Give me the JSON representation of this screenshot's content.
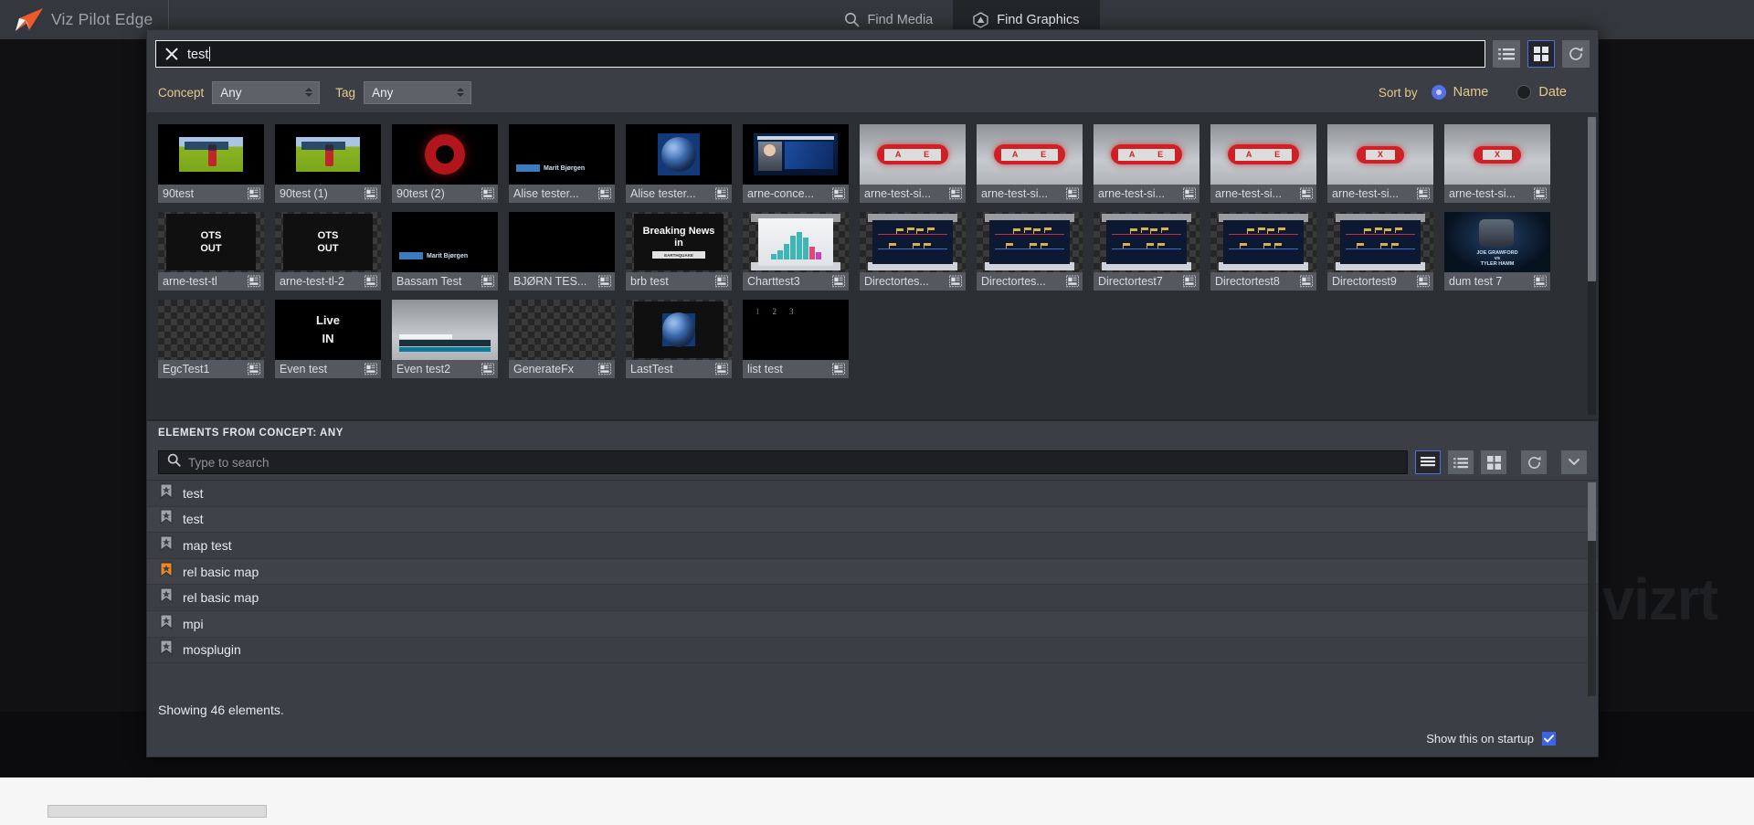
{
  "app": {
    "brand": "Viz Pilot Edge",
    "logo_icon": "viz-arrow-logo"
  },
  "topbar": {
    "tabs": [
      {
        "label": "Find Media",
        "icon": "search-icon",
        "active": false
      },
      {
        "label": "Find Graphics",
        "icon": "hexagon-graphics-icon",
        "active": true
      }
    ]
  },
  "search": {
    "value": "test",
    "clear_icon": "close-x-icon",
    "view_list_icon": "list-view-icon",
    "view_grid_icon": "grid-view-icon",
    "refresh_icon": "refresh-icon",
    "active_view": "grid"
  },
  "filters": {
    "concept_label": "Concept",
    "concept_value": "Any",
    "tag_label": "Tag",
    "tag_value": "Any",
    "sort_by_label": "Sort by",
    "sort_options": [
      {
        "label": "Name",
        "selected": true
      },
      {
        "label": "Date",
        "selected": false
      }
    ]
  },
  "grid": {
    "template_icon": "template-badge-icon",
    "items": [
      {
        "name": "90test",
        "art": "field",
        "row": 1
      },
      {
        "name": "90test (1)",
        "art": "field",
        "row": 1
      },
      {
        "name": "90test (2)",
        "art": "torus",
        "row": 1
      },
      {
        "name": "Alise tester...",
        "art": "lower3rd",
        "row": 1,
        "caption": "Marit Bjørgen"
      },
      {
        "name": "Alise tester...",
        "art": "globe",
        "row": 1
      },
      {
        "name": "arne-conce...",
        "art": "presenter",
        "row": 1
      },
      {
        "name": "arne-test-si...",
        "art": "ae-badge",
        "row": 1
      },
      {
        "name": "arne-test-si...",
        "art": "ae-badge",
        "row": 1
      },
      {
        "name": "arne-test-si...",
        "art": "ae-badge",
        "row": 1
      },
      {
        "name": "arne-test-si...",
        "art": "ae-badge",
        "row": 1
      },
      {
        "name": "arne-test-si...",
        "art": "x-badge",
        "row": 2
      },
      {
        "name": "arne-test-si...",
        "art": "x-badge",
        "row": 2
      },
      {
        "name": "arne-test-tl",
        "art": "ots",
        "row": 2,
        "caption": "OTS OUT"
      },
      {
        "name": "arne-test-tl-2",
        "art": "ots",
        "row": 2,
        "caption": "OTS OUT"
      },
      {
        "name": "Bassam Test",
        "art": "lower3rd",
        "row": 2,
        "caption": "Marit Bjørgen"
      },
      {
        "name": "BJØRN TES...",
        "art": "black",
        "row": 2
      },
      {
        "name": "brb test",
        "art": "breaking",
        "row": 2,
        "caption": "Breaking News in"
      },
      {
        "name": "Charttest3",
        "art": "chart",
        "row": 2
      },
      {
        "name": "Directortes...",
        "art": "director",
        "row": 2
      },
      {
        "name": "Directortes...",
        "art": "director",
        "row": 2
      },
      {
        "name": "Directortest7",
        "art": "director",
        "row": 3
      },
      {
        "name": "Directortest8",
        "art": "director",
        "row": 3
      },
      {
        "name": "Directortest9",
        "art": "director",
        "row": 3
      },
      {
        "name": "dum test 7",
        "art": "duel",
        "row": 3
      },
      {
        "name": "EgcTest1",
        "art": "empty",
        "row": 3
      },
      {
        "name": "Even test",
        "art": "livein",
        "row": 3,
        "caption": "Live IN"
      },
      {
        "name": "Even test2",
        "art": "evenbars",
        "row": 3
      },
      {
        "name": "GenerateFx",
        "art": "empty",
        "row": 3
      },
      {
        "name": "LastTest",
        "art": "globe2",
        "row": 3
      },
      {
        "name": "list test",
        "art": "listnums",
        "row": 3
      }
    ]
  },
  "elements_panel": {
    "title": "ELEMENTS FROM CONCEPT: ANY",
    "search_placeholder": "Type to search",
    "search_icon": "search-icon",
    "view_detail_icon": "detail-view-icon",
    "view_list_icon": "list-view-icon",
    "view_grid_icon": "grid-view-icon",
    "refresh_icon": "refresh-icon",
    "collapse_icon": "chevron-double-down-icon",
    "active_view": "detail",
    "rows": [
      {
        "label": "test",
        "icon": "bookmark-star-icon",
        "highlighted": false
      },
      {
        "label": "test",
        "icon": "bookmark-star-icon",
        "highlighted": false
      },
      {
        "label": "map test",
        "icon": "bookmark-star-icon",
        "highlighted": false
      },
      {
        "label": "rel basic map",
        "icon": "bookmark-star-icon",
        "highlighted": true
      },
      {
        "label": "rel basic map",
        "icon": "bookmark-star-icon",
        "highlighted": false
      },
      {
        "label": "mpi",
        "icon": "bookmark-star-icon",
        "highlighted": false
      },
      {
        "label": "mosplugin",
        "icon": "bookmark-star-icon",
        "highlighted": false
      }
    ]
  },
  "footer": {
    "count_text": "Showing 46 elements.",
    "startup_label": "Show this on startup",
    "startup_checked": true,
    "check_icon": "checkmark-icon"
  },
  "background": {
    "watermark": "vizrt"
  },
  "colors": {
    "accent_blue": "#4e6fe0",
    "panel": "#3b3e44",
    "appbar": "#34373d",
    "label_gold": "#e7c98a",
    "highlight_orange": "#f08a1e",
    "checkbox_blue": "#3c63e8"
  }
}
